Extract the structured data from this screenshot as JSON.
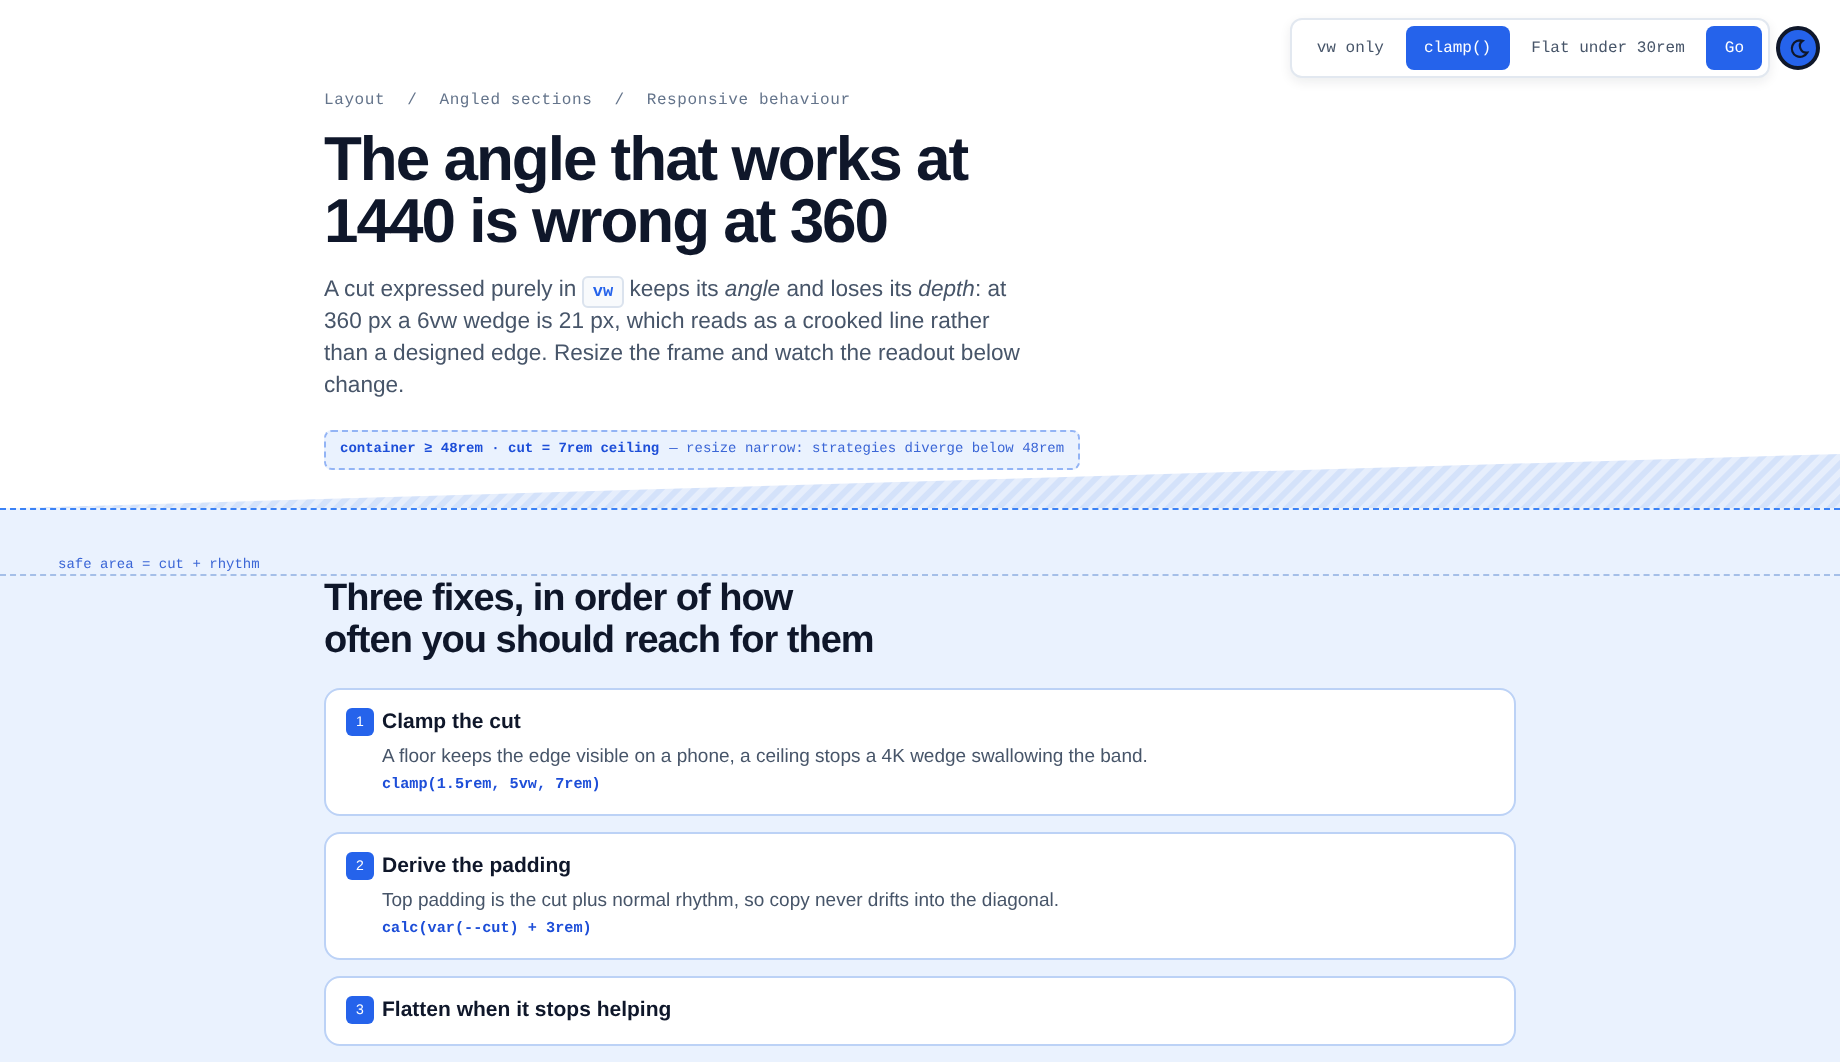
{
  "toolbar": {
    "options": [
      {
        "label": "vw only",
        "selected": false,
        "kind": "toggle"
      },
      {
        "label": "clamp()",
        "selected": true,
        "kind": "toggle"
      },
      {
        "label": "Flat under 30rem",
        "selected": false,
        "kind": "toggle"
      },
      {
        "label": "Go",
        "selected": true,
        "kind": "toggle"
      }
    ]
  },
  "breadcrumb": [
    "Layout",
    "/",
    "Angled sections",
    "/",
    "Responsive behaviour"
  ],
  "title": "The angle that works at 1440 is wrong at 360",
  "intro": {
    "before": "A cut expressed purely in",
    "code": "vw",
    "after": "keeps its *angle* and loses its *depth*: at 360 px a 6vw wedge is 21 px, which reads as a crooked line rather than a designed edge. Resize the frame and watch the readout below change."
  },
  "readout": {
    "value": "container ≥ 48rem · cut = 7rem ceiling",
    "note": "— resize narrow: strategies diverge below 48rem"
  },
  "safe_area_label": "safe area = cut + rhythm",
  "fixes": {
    "heading": "Three fixes, in order of how often you should reach for them",
    "items": [
      {
        "number": "1",
        "title": "Clamp the cut",
        "text": "A floor keeps the edge visible on a phone, a ceiling stops a 4K wedge swallowing the band.",
        "code": "clamp(1.5rem, 5vw, 7rem)"
      },
      {
        "number": "2",
        "title": "Derive the padding",
        "text": "Top padding is the cut plus normal rhythm, so copy never drifts into the diagonal.",
        "code": "calc(var(--cut) + 3rem)"
      },
      {
        "number": "3",
        "title": "Flatten when it stops helping"
      }
    ]
  }
}
